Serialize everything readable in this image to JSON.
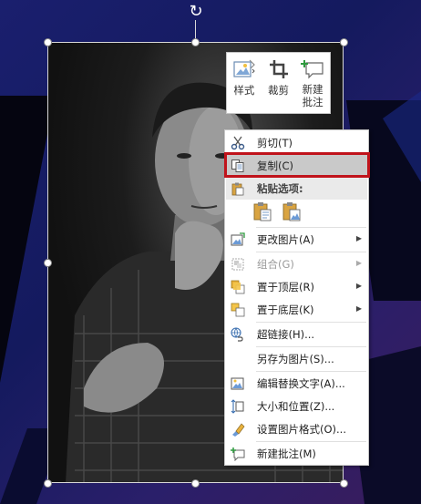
{
  "mini_toolbar": {
    "style_label": "样式",
    "crop_label": "裁剪",
    "new_comment_label": "新建\n批注",
    "new_comment_line1": "新建",
    "new_comment_line2": "批注"
  },
  "context_menu": {
    "items": [
      {
        "label": "剪切(T)",
        "icon": "scissors-icon",
        "enabled": true,
        "submenu": false
      },
      {
        "label": "复制(C)",
        "icon": "copy-icon",
        "enabled": true,
        "submenu": false,
        "highlighted": true
      },
      {
        "label": "粘贴选项:",
        "icon": "paste-icon",
        "enabled": true,
        "submenu": false,
        "header": true
      },
      {
        "label": "更改图片(A)",
        "icon": "change-picture-icon",
        "enabled": true,
        "submenu": true
      },
      {
        "label": "组合(G)",
        "icon": "group-icon",
        "enabled": false,
        "submenu": true
      },
      {
        "label": "置于顶层(R)",
        "icon": "bring-to-front-icon",
        "enabled": true,
        "submenu": true
      },
      {
        "label": "置于底层(K)",
        "icon": "send-to-back-icon",
        "enabled": true,
        "submenu": true
      },
      {
        "label": "超链接(H)...",
        "icon": "hyperlink-icon",
        "enabled": true,
        "submenu": false
      },
      {
        "label": "另存为图片(S)...",
        "icon": "",
        "enabled": true,
        "submenu": false
      },
      {
        "label": "编辑替换文字(A)...",
        "icon": "alt-text-icon",
        "enabled": true,
        "submenu": false
      },
      {
        "label": "大小和位置(Z)...",
        "icon": "size-position-icon",
        "enabled": true,
        "submenu": false
      },
      {
        "label": "设置图片格式(O)...",
        "icon": "format-picture-icon",
        "enabled": true,
        "submenu": false
      },
      {
        "label": "新建批注(M)",
        "icon": "new-comment-icon",
        "enabled": true,
        "submenu": false
      }
    ]
  },
  "colors": {
    "highlight_border": "#c0131b",
    "menu_hover": "#c9c9c9",
    "slide_background": "#1a1f6e"
  }
}
